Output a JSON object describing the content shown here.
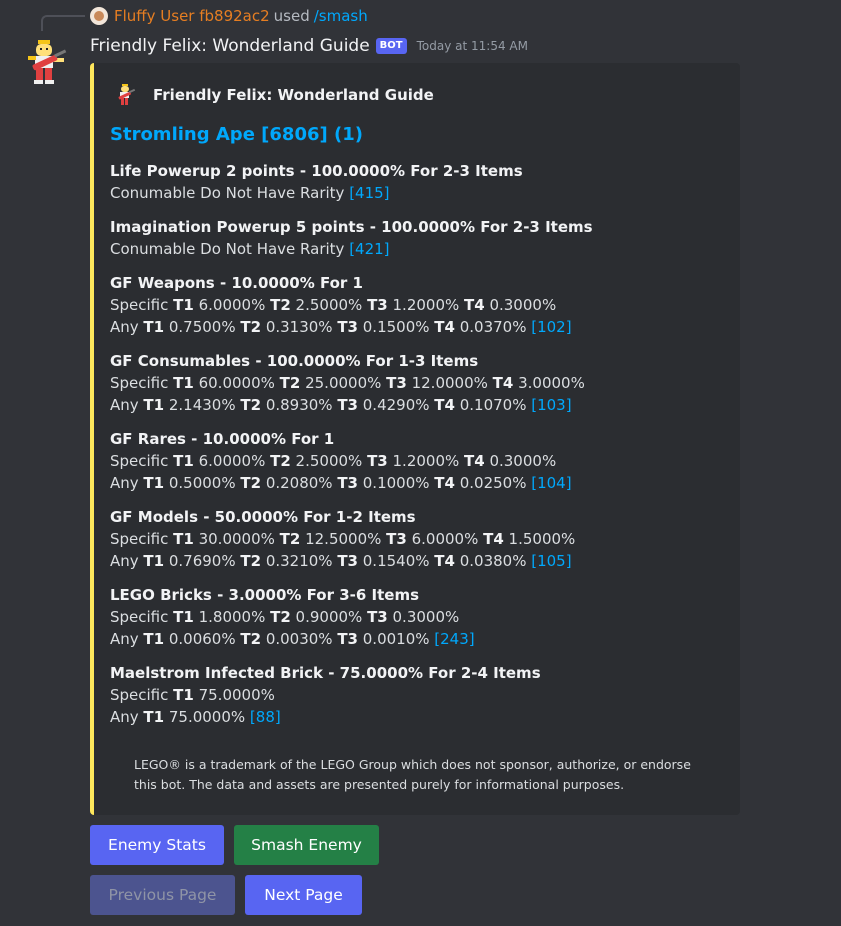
{
  "reply": {
    "user": "Fluffy User fb892ac2",
    "action": "used",
    "command": "/smash"
  },
  "message": {
    "bot_name": "Friendly Felix: Wonderland Guide",
    "badge": "BOT",
    "timestamp": "Today at 11:54 AM"
  },
  "embed": {
    "accent_color": "#fee75c",
    "author": "Friendly Felix: Wonderland Guide",
    "title": "Stromling Ape [6806] (1)",
    "fields": [
      {
        "name": "Life Powerup 2 points - 100.0000% For 2-3 Items",
        "lines": [
          [
            {
              "t": "Conumable Do Not Have Rarity "
            },
            {
              "t": "[415]",
              "link": true
            }
          ]
        ]
      },
      {
        "name": "Imagination Powerup 5 points - 100.0000% For 2-3 Items",
        "lines": [
          [
            {
              "t": "Conumable Do Not Have Rarity "
            },
            {
              "t": "[421]",
              "link": true
            }
          ]
        ]
      },
      {
        "name": "GF Weapons - 10.0000% For 1",
        "lines": [
          [
            {
              "t": "Specific "
            },
            {
              "t": "T1",
              "b": true
            },
            {
              "t": " 6.0000% "
            },
            {
              "t": "T2",
              "b": true
            },
            {
              "t": " 2.5000% "
            },
            {
              "t": "T3",
              "b": true
            },
            {
              "t": " 1.2000% "
            },
            {
              "t": "T4",
              "b": true
            },
            {
              "t": " 0.3000%"
            }
          ],
          [
            {
              "t": "Any "
            },
            {
              "t": "T1",
              "b": true
            },
            {
              "t": " 0.7500% "
            },
            {
              "t": "T2",
              "b": true
            },
            {
              "t": " 0.3130% "
            },
            {
              "t": "T3",
              "b": true
            },
            {
              "t": " 0.1500% "
            },
            {
              "t": "T4",
              "b": true
            },
            {
              "t": " 0.0370% "
            },
            {
              "t": "[102]",
              "link": true
            }
          ]
        ]
      },
      {
        "name": "GF Consumables - 100.0000% For 1-3 Items",
        "lines": [
          [
            {
              "t": "Specific "
            },
            {
              "t": "T1",
              "b": true
            },
            {
              "t": " 60.0000% "
            },
            {
              "t": "T2",
              "b": true
            },
            {
              "t": " 25.0000% "
            },
            {
              "t": "T3",
              "b": true
            },
            {
              "t": " 12.0000% "
            },
            {
              "t": "T4",
              "b": true
            },
            {
              "t": " 3.0000%"
            }
          ],
          [
            {
              "t": "Any "
            },
            {
              "t": "T1",
              "b": true
            },
            {
              "t": " 2.1430% "
            },
            {
              "t": "T2",
              "b": true
            },
            {
              "t": " 0.8930% "
            },
            {
              "t": "T3",
              "b": true
            },
            {
              "t": " 0.4290% "
            },
            {
              "t": "T4",
              "b": true
            },
            {
              "t": " 0.1070% "
            },
            {
              "t": "[103]",
              "link": true
            }
          ]
        ]
      },
      {
        "name": "GF Rares - 10.0000% For 1",
        "lines": [
          [
            {
              "t": "Specific "
            },
            {
              "t": "T1",
              "b": true
            },
            {
              "t": " 6.0000% "
            },
            {
              "t": "T2",
              "b": true
            },
            {
              "t": " 2.5000% "
            },
            {
              "t": "T3",
              "b": true
            },
            {
              "t": " 1.2000% "
            },
            {
              "t": "T4",
              "b": true
            },
            {
              "t": " 0.3000%"
            }
          ],
          [
            {
              "t": "Any "
            },
            {
              "t": "T1",
              "b": true
            },
            {
              "t": " 0.5000% "
            },
            {
              "t": "T2",
              "b": true
            },
            {
              "t": " 0.2080% "
            },
            {
              "t": "T3",
              "b": true
            },
            {
              "t": " 0.1000% "
            },
            {
              "t": "T4",
              "b": true
            },
            {
              "t": " 0.0250% "
            },
            {
              "t": "[104]",
              "link": true
            }
          ]
        ]
      },
      {
        "name": "GF Models - 50.0000% For 1-2 Items",
        "lines": [
          [
            {
              "t": "Specific "
            },
            {
              "t": "T1",
              "b": true
            },
            {
              "t": " 30.0000% "
            },
            {
              "t": "T2",
              "b": true
            },
            {
              "t": " 12.5000% "
            },
            {
              "t": "T3",
              "b": true
            },
            {
              "t": " 6.0000% "
            },
            {
              "t": "T4",
              "b": true
            },
            {
              "t": " 1.5000%"
            }
          ],
          [
            {
              "t": "Any "
            },
            {
              "t": "T1",
              "b": true
            },
            {
              "t": " 0.7690% "
            },
            {
              "t": "T2",
              "b": true
            },
            {
              "t": " 0.3210% "
            },
            {
              "t": "T3",
              "b": true
            },
            {
              "t": " 0.1540% "
            },
            {
              "t": "T4",
              "b": true
            },
            {
              "t": " 0.0380% "
            },
            {
              "t": "[105]",
              "link": true
            }
          ]
        ]
      },
      {
        "name": "LEGO Bricks - 3.0000% For 3-6 Items",
        "lines": [
          [
            {
              "t": "Specific "
            },
            {
              "t": "T1",
              "b": true
            },
            {
              "t": " 1.8000% "
            },
            {
              "t": "T2",
              "b": true
            },
            {
              "t": " 0.9000% "
            },
            {
              "t": "T3",
              "b": true
            },
            {
              "t": " 0.3000%"
            }
          ],
          [
            {
              "t": "Any "
            },
            {
              "t": "T1",
              "b": true
            },
            {
              "t": " 0.0060% "
            },
            {
              "t": "T2",
              "b": true
            },
            {
              "t": " 0.0030% "
            },
            {
              "t": "T3",
              "b": true
            },
            {
              "t": " 0.0010% "
            },
            {
              "t": "[243]",
              "link": true
            }
          ]
        ]
      },
      {
        "name": "Maelstrom Infected Brick - 75.0000% For 2-4 Items",
        "lines": [
          [
            {
              "t": "Specific "
            },
            {
              "t": "T1",
              "b": true
            },
            {
              "t": " 75.0000%"
            }
          ],
          [
            {
              "t": "Any "
            },
            {
              "t": "T1",
              "b": true
            },
            {
              "t": " 75.0000% "
            },
            {
              "t": "[88]",
              "link": true
            }
          ]
        ]
      }
    ],
    "footer": "LEGO® is a trademark of the LEGO Group which does not sponsor, authorize, or endorse this bot. The data and assets are presented purely for informational purposes."
  },
  "buttons": {
    "enemy_stats": "Enemy Stats",
    "smash_enemy": "Smash Enemy",
    "previous_page": "Previous Page",
    "next_page": "Next Page"
  },
  "icons": {
    "reply_avatar": "user-avatar-icon",
    "bot_avatar": "minifigure-guitar-icon",
    "author_icon": "minifigure-guitar-icon"
  }
}
